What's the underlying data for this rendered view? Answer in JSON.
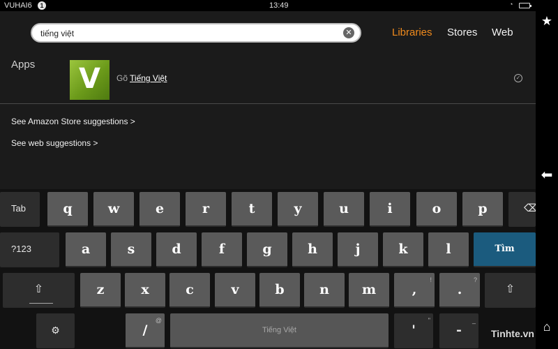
{
  "status_bar": {
    "carrier": "VUHAI6",
    "notification_count": "1",
    "time": "13:49"
  },
  "search": {
    "value": "tiếng việt",
    "clear_icon": "close-circle-icon"
  },
  "tabs": [
    {
      "label": "Libraries",
      "active": true
    },
    {
      "label": "Stores",
      "active": false
    },
    {
      "label": "Web",
      "active": false
    }
  ],
  "results": {
    "section_label": "Apps",
    "app_icon_letter": "V",
    "app_prefix": "Gõ",
    "app_name": "Tiếng Việt"
  },
  "suggestions": {
    "amazon": "See Amazon Store suggestions >",
    "web": "See web suggestions >"
  },
  "keyboard": {
    "row1": [
      "Tab",
      "q",
      "w",
      "e",
      "r",
      "t",
      "y",
      "u",
      "i",
      "o",
      "p"
    ],
    "row2": [
      "?123",
      "a",
      "s",
      "d",
      "f",
      "g",
      "h",
      "j",
      "k",
      "l",
      "Tìm"
    ],
    "row3": [
      "z",
      "x",
      "c",
      "v",
      "b",
      "n",
      "m",
      ",",
      "."
    ],
    "row3_subs": {
      "comma": "!",
      "period": "?"
    },
    "row4": {
      "slash": "/",
      "slash_sub": "@",
      "space": "Tiếng Việt",
      "apostrophe": "'",
      "apostrophe_sub": "\"",
      "dash": "-",
      "dash_sub": "_"
    }
  },
  "icons": {
    "star": "star-icon",
    "back": "back-arrow-icon",
    "home": "home-icon",
    "shift": "shift-icon",
    "backspace": "backspace-icon",
    "settings": "keyboard-settings-icon"
  },
  "colors": {
    "accent": "#f08a1c",
    "enter_key": "#1b5b7e",
    "app_icon": "#7fae29"
  },
  "watermark": "Tinhte.vn"
}
